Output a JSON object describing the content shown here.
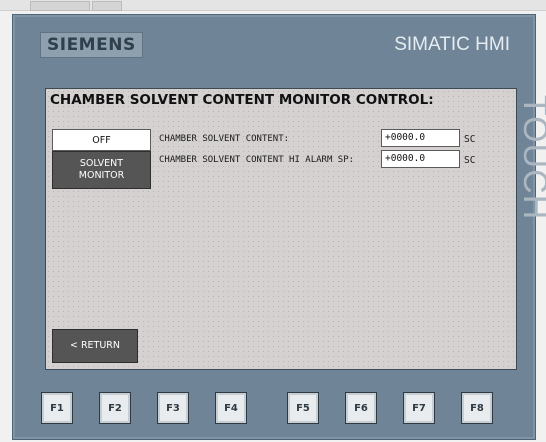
{
  "device": {
    "brand": "SIEMENS",
    "product": "SIMATIC HMI",
    "side_label": "TOUCH"
  },
  "screen": {
    "title": "CHAMBER SOLVENT CONTENT MONITOR CONTROL:",
    "off_button": "OFF",
    "solvent_monitor_button": {
      "line1": "SOLVENT",
      "line2": "MONITOR"
    },
    "return_button": "< RETURN",
    "fields": [
      {
        "label": "CHAMBER SOLVENT CONTENT:",
        "value": "+0000.0",
        "unit": "SC"
      },
      {
        "label": "CHAMBER SOLVENT CONTENT HI ALARM SP:",
        "value": "+0000.0",
        "unit": "SC"
      }
    ]
  },
  "function_keys": [
    "F1",
    "F2",
    "F3",
    "F4",
    "F5",
    "F6",
    "F7",
    "F8"
  ]
}
